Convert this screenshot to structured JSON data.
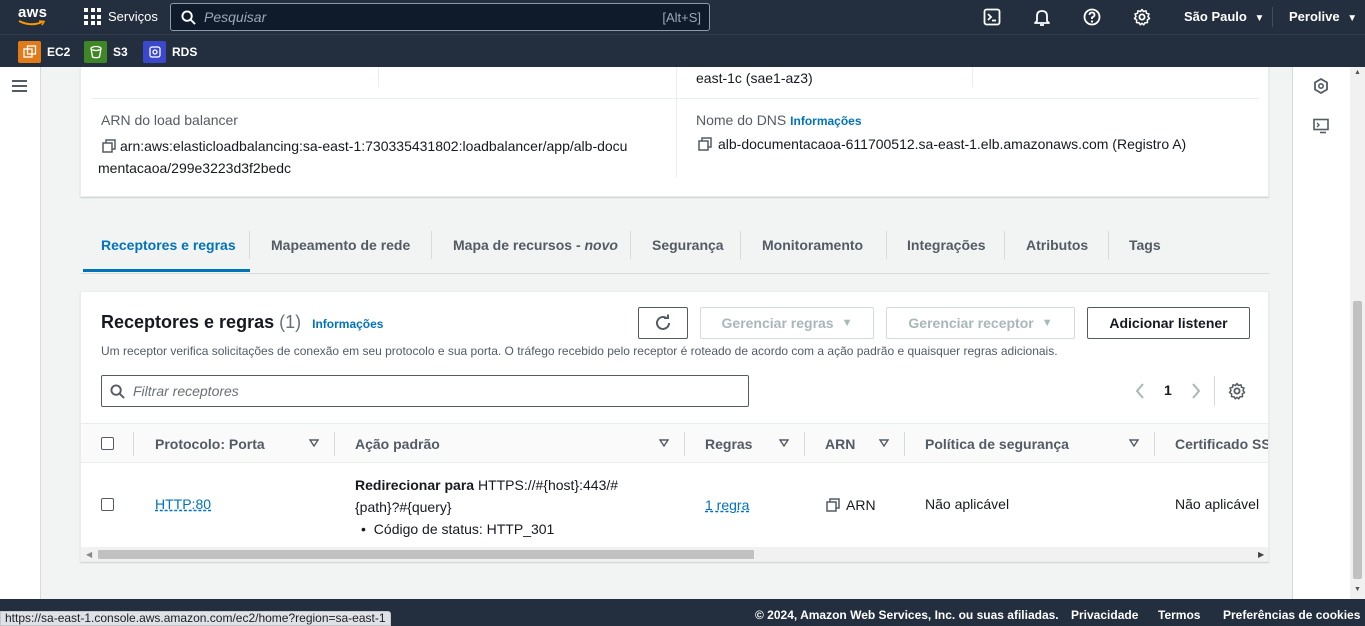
{
  "topnav": {
    "logo_text": "aws",
    "services_label": "Serviços",
    "search_placeholder": "Pesquisar",
    "search_shortcut": "[Alt+S]",
    "region": "São Paulo",
    "account": "Perolive"
  },
  "favorites": [
    {
      "label": "EC2",
      "color": "#e07b1a"
    },
    {
      "label": "S3",
      "color": "#3f8624"
    },
    {
      "label": "RDS",
      "color": "#3b48cc"
    }
  ],
  "details": {
    "az_text": "east-1c (sae1-az3)",
    "arn_label": "ARN do load balancer",
    "arn_line1": "arn:aws:elasticloadbalancing:sa-east-1:730335431802:loadbalancer/app/alb-docu",
    "arn_line2": "mentacaoa/299e3223d3f2bedc",
    "dns_label": "Nome do DNS",
    "info_label": "Informações",
    "dns_value": "alb-documentacaoa-611700512.sa-east-1.elb.amazonaws.com (Registro A)"
  },
  "tabs": [
    {
      "label": "Receptores e regras",
      "active": true
    },
    {
      "label": "Mapeamento de rede"
    },
    {
      "label": "Mapa de recursos - ",
      "suffix": "novo"
    },
    {
      "label": "Segurança"
    },
    {
      "label": "Monitoramento"
    },
    {
      "label": "Integrações"
    },
    {
      "label": "Atributos"
    },
    {
      "label": "Tags"
    }
  ],
  "listeners": {
    "title": "Receptores e regras",
    "count": "(1)",
    "info_label": "Informações",
    "manage_rules": "Gerenciar regras",
    "manage_listener": "Gerenciar receptor",
    "add_listener": "Adicionar listener",
    "description": "Um receptor verifica solicitações de conexão em seu protocolo e sua porta. O tráfego recebido pelo receptor é roteado de acordo com a ação padrão e quaisquer regras adicionais.",
    "filter_placeholder": "Filtrar receptores",
    "page": "1",
    "columns": [
      "Protocolo: Porta",
      "Ação padrão",
      "Regras",
      "ARN",
      "Política de segurança",
      "Certificado SSL"
    ],
    "rows": [
      {
        "protocol": "HTTP:80",
        "action_bold": "Redirecionar para",
        "action_line1": " HTTPS://#{host}:443/#",
        "action_line2": "{path}?#{query}",
        "action_bullet": "Código de status: HTTP_301",
        "rules": "1 regra",
        "arn": "ARN",
        "policy": "Não aplicável",
        "certificate": "Não aplicável"
      }
    ]
  },
  "footer": {
    "copyright": "© 2024, Amazon Web Services, Inc. ou suas afiliadas.",
    "privacy": "Privacidade",
    "terms": "Termos",
    "cookies": "Preferências de cookies"
  },
  "status_url": "https://sa-east-1.console.aws.amazon.com/ec2/home?region=sa-east-1"
}
